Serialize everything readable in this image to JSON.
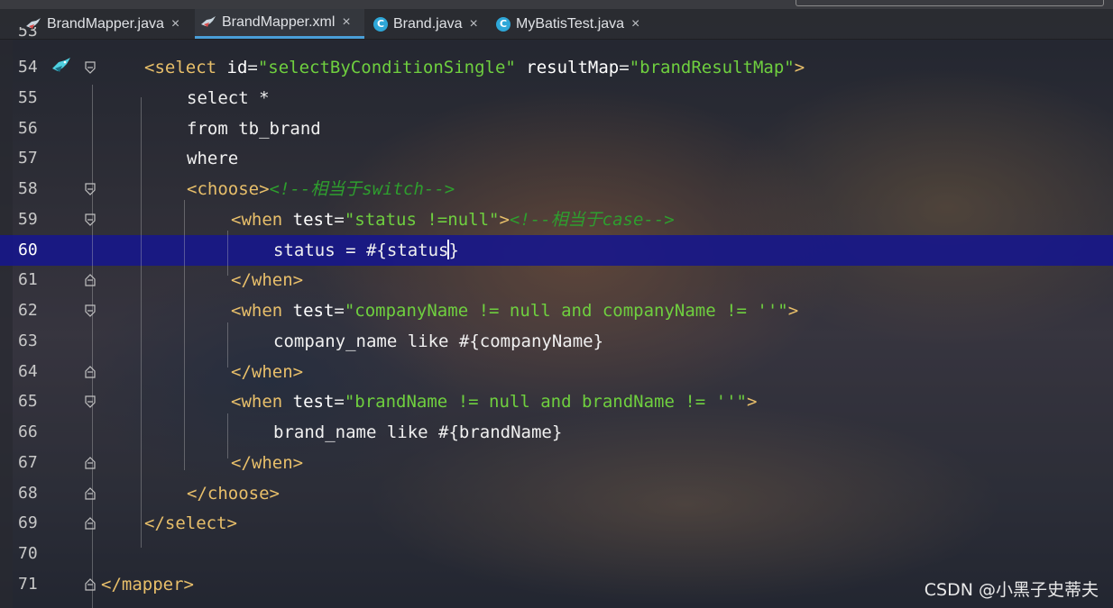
{
  "tabs": [
    {
      "label": "BrandMapper.java",
      "icon": "mybatis-bird-icon",
      "active": false
    },
    {
      "label": "BrandMapper.xml",
      "icon": "mybatis-bird-icon",
      "active": true
    },
    {
      "label": "Brand.java",
      "icon": "class-icon",
      "active": false
    },
    {
      "label": "MyBatisTest.java",
      "icon": "class-run-icon",
      "active": false
    }
  ],
  "tab_close_glyph": "×",
  "class_icon_letter": "C",
  "partial_line_number": "53",
  "lines": [
    {
      "num": "54",
      "tokens": [
        [
          "t-tag",
          "<select "
        ],
        [
          "t-attr",
          "id"
        ],
        [
          "t-eq",
          "="
        ],
        [
          "t-val",
          "\"selectByConditionSingle\""
        ],
        [
          "t-eq",
          " "
        ],
        [
          "t-attr",
          "resultMap"
        ],
        [
          "t-eq",
          "="
        ],
        [
          "t-val",
          "\"brandResultMap\""
        ],
        [
          "t-tag",
          ">"
        ]
      ]
    },
    {
      "num": "55",
      "tokens": [
        [
          "t-kw",
          "select *"
        ]
      ]
    },
    {
      "num": "56",
      "tokens": [
        [
          "t-kw",
          "from tb_brand"
        ]
      ]
    },
    {
      "num": "57",
      "tokens": [
        [
          "t-kw",
          "where"
        ]
      ]
    },
    {
      "num": "58",
      "tokens": [
        [
          "t-tag",
          "<choose>"
        ],
        [
          "t-cm",
          "<!--相当于switch-->"
        ]
      ]
    },
    {
      "num": "59",
      "tokens": [
        [
          "t-tag",
          "<when "
        ],
        [
          "t-attr",
          "test"
        ],
        [
          "t-eq",
          "="
        ],
        [
          "t-val",
          "\"status !=null\""
        ],
        [
          "t-tag",
          ">"
        ],
        [
          "t-cm",
          "<!--相当于case-->"
        ]
      ]
    },
    {
      "num": "60",
      "tokens": [
        [
          "t-kw",
          "status = #{status"
        ],
        [
          "caret",
          ""
        ],
        [
          "t-kw",
          "}"
        ]
      ]
    },
    {
      "num": "61",
      "tokens": [
        [
          "t-tag",
          "</when>"
        ]
      ]
    },
    {
      "num": "62",
      "tokens": [
        [
          "t-tag",
          "<when "
        ],
        [
          "t-attr",
          "test"
        ],
        [
          "t-eq",
          "="
        ],
        [
          "t-val",
          "\"companyName != null and companyName != ''\""
        ],
        [
          "t-tag",
          ">"
        ]
      ]
    },
    {
      "num": "63",
      "tokens": [
        [
          "t-kw",
          "company_name like #{companyName}"
        ]
      ]
    },
    {
      "num": "64",
      "tokens": [
        [
          "t-tag",
          "</when>"
        ]
      ]
    },
    {
      "num": "65",
      "tokens": [
        [
          "t-tag",
          "<when "
        ],
        [
          "t-attr",
          "test"
        ],
        [
          "t-eq",
          "="
        ],
        [
          "t-val",
          "\"brandName != null and brandName != ''\""
        ],
        [
          "t-tag",
          ">"
        ]
      ]
    },
    {
      "num": "66",
      "tokens": [
        [
          "t-kw",
          "brand_name like #{brandName}"
        ]
      ]
    },
    {
      "num": "67",
      "tokens": [
        [
          "t-tag",
          "</when>"
        ]
      ]
    },
    {
      "num": "68",
      "tokens": [
        [
          "t-tag",
          "</choose>"
        ]
      ]
    },
    {
      "num": "69",
      "tokens": [
        [
          "t-tag",
          "</select>"
        ]
      ]
    },
    {
      "num": "70",
      "tokens": []
    },
    {
      "num": "71",
      "tokens": [
        [
          "t-tag",
          "</mapper>"
        ]
      ]
    }
  ],
  "current_line": "60",
  "watermark": "CSDN @小黑子史蒂夫",
  "colors": {
    "tag": "#e8bf6a",
    "value": "#6fcf3f",
    "comment": "#2e9e2e",
    "current_line_bg": "#16168c",
    "active_tab_underline": "#4a9fd8"
  }
}
